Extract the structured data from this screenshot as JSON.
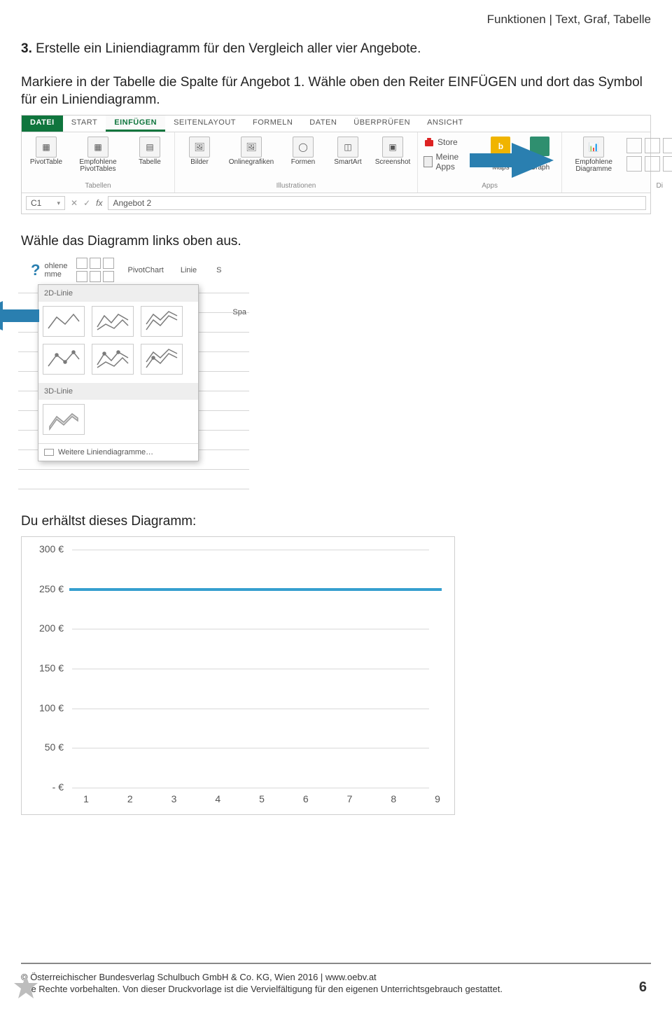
{
  "header": {
    "breadcrumb": "Funktionen | Text, Graf, Tabelle"
  },
  "task": {
    "num": "3.",
    "text": "Erstelle ein Liniendiagramm für den Vergleich aller vier Angebote."
  },
  "para1": "Markiere in der Tabelle die Spalte für Angebot 1. Wähle oben den Reiter EINFÜGEN und dort das Symbol für ein Liniendiagramm.",
  "caption2": "Wähle das Diagramm links oben aus.",
  "caption3": "Du erhältst dieses Diagramm:",
  "ribbon": {
    "tabs": [
      "DATEI",
      "START",
      "EINFÜGEN",
      "SEITENLAYOUT",
      "FORMELN",
      "DATEN",
      "ÜBERPRÜFEN",
      "ANSICHT"
    ],
    "active_tab": "EINFÜGEN",
    "groups": {
      "tables": {
        "name": "Tabellen",
        "items": [
          "PivotTable",
          "Empfohlene PivotTables",
          "Tabelle"
        ]
      },
      "illustrations": {
        "name": "Illustrationen",
        "items": [
          "Bilder",
          "Onlinegrafiken",
          "Formen",
          "SmartArt",
          "Screenshot"
        ]
      },
      "apps": {
        "name": "Apps",
        "store": "Store",
        "myapps": "Meine Apps",
        "bing": "Bing Maps",
        "people": "People Graph"
      },
      "charts": {
        "name": "Di",
        "recommended": "Empfohlene Diagramme",
        "pivotchart": "PivotChart"
      }
    },
    "formula_bar": {
      "cell_ref": "C1",
      "fx": "fx",
      "value": "Angebot 2"
    }
  },
  "dropdown": {
    "head_left": "ohlene",
    "head_left2": "mme",
    "head_center": "PivotChart",
    "head_right": "Linie",
    "head_far_right": "S",
    "side_label": "Spa",
    "section_2d": "2D-Linie",
    "section_3d": "3D-Linie",
    "more": "Weitere Liniendiagramme…"
  },
  "chart_data": {
    "type": "line",
    "categories": [
      "1",
      "2",
      "3",
      "4",
      "5",
      "6",
      "7",
      "8",
      "9"
    ],
    "values": [
      250,
      250,
      250,
      250,
      250,
      250,
      250,
      250,
      250
    ],
    "title": "",
    "xlabel": "",
    "ylabel": "",
    "ylim": [
      0,
      300
    ],
    "y_ticks": [
      "300 €",
      "250 €",
      "200 €",
      "150 €",
      "100 €",
      "50 €",
      "-   €"
    ]
  },
  "footer": {
    "line1": "© Österreichischer Bundesverlag Schulbuch GmbH & Co. KG, Wien 2016 | www.oebv.at",
    "line2": "Alle Rechte vorbehalten. Von dieser Druckvorlage ist die Vervielfältigung für den eigenen Unterrichtsgebrauch gestattet.",
    "page_number": "6"
  }
}
